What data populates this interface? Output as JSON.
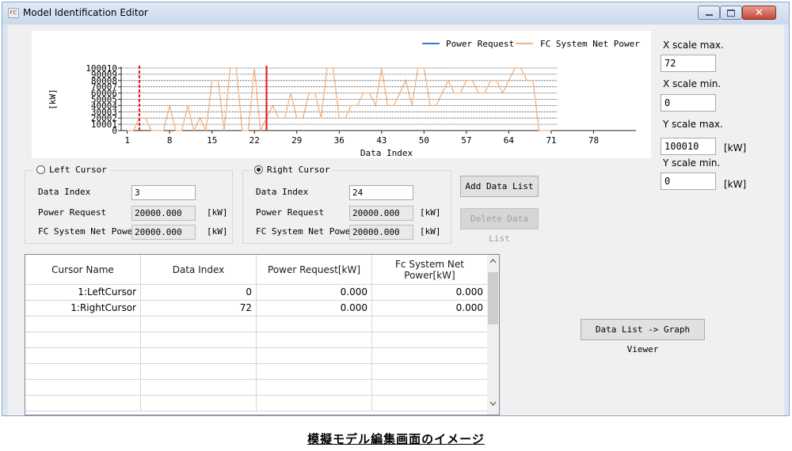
{
  "window": {
    "title": "Model Identification Editor",
    "app_icon": "model-app-icon"
  },
  "chart_data": {
    "type": "line",
    "xlabel": "Data Index",
    "ylabel": "[kW]",
    "xlim": [
      0,
      85
    ],
    "ylim": [
      0,
      100010
    ],
    "x_ticks": [
      1,
      8,
      15,
      22,
      29,
      36,
      43,
      50,
      57,
      64,
      71,
      78
    ],
    "y_ticks": [
      0,
      10001,
      20002,
      30003,
      40004,
      50005,
      60006,
      70007,
      80008,
      90009,
      100010
    ],
    "legend_position": "top-right",
    "grid": true,
    "series": [
      {
        "name": "Power Request",
        "color": "#3a78d6",
        "values": []
      },
      {
        "name": "FC System Net Power",
        "color": "#f0b383",
        "x": [
          1,
          2,
          3,
          4,
          5,
          6,
          7,
          8,
          9,
          10,
          11,
          12,
          13,
          14,
          15,
          16,
          17,
          18,
          19,
          20,
          21,
          22,
          23,
          24,
          25,
          26,
          27,
          28,
          29,
          30,
          31,
          32,
          33,
          34,
          35,
          36,
          37,
          38,
          39,
          40,
          41,
          42,
          43,
          44,
          45,
          46,
          47,
          48,
          49,
          50,
          51,
          52,
          53,
          54,
          55,
          56,
          57,
          58,
          59,
          60,
          61,
          62,
          63,
          64,
          65,
          66,
          67,
          68,
          69,
          70,
          71
        ],
        "values": [
          0,
          0,
          20000,
          20000,
          0,
          0,
          0,
          40000,
          0,
          0,
          40000,
          0,
          20000,
          0,
          80000,
          80000,
          0,
          100000,
          100000,
          0,
          0,
          100000,
          0,
          20000,
          40000,
          20000,
          20000,
          60000,
          20000,
          20000,
          60000,
          60000,
          20000,
          100000,
          100000,
          20000,
          20000,
          40000,
          40000,
          60000,
          60000,
          40000,
          100000,
          40000,
          40000,
          60000,
          80000,
          40000,
          100000,
          100000,
          40000,
          40000,
          60000,
          80000,
          60000,
          60000,
          80000,
          80000,
          60000,
          60000,
          80000,
          80000,
          60000,
          80000,
          100000,
          100000,
          80000,
          80000,
          0,
          0,
          0
        ]
      }
    ],
    "cursors": [
      {
        "name": "Left Cursor",
        "index": 3,
        "color": "#e8222a",
        "dashed": true
      },
      {
        "name": "Right Cursor",
        "index": 24,
        "color": "#e8222a",
        "dashed": false
      }
    ]
  },
  "scale": {
    "x_max_label": "X scale max.",
    "x_max": "72",
    "x_min_label": "X scale min.",
    "x_min": "0",
    "y_max_label": "Y scale max.",
    "y_max": "100010",
    "y_max_unit": "[kW]",
    "y_min_label": "Y scale min.",
    "y_min": "0",
    "y_min_unit": "[kW]"
  },
  "left_cursor": {
    "title": "Left Cursor",
    "selected": false,
    "index_label": "Data Index",
    "index": "3",
    "power_label": "Power Request",
    "power": "20000.000",
    "power_unit": "[kW]",
    "fc_label": "FC System Net Power",
    "fc": "20000.000",
    "fc_unit": "[kW]"
  },
  "right_cursor": {
    "title": "Right Cursor",
    "selected": true,
    "index_label": "Data Index",
    "index": "24",
    "power_label": "Power Request",
    "power": "20000.000",
    "power_unit": "[kW]",
    "fc_label": "FC System Net Power",
    "fc": "20000.000",
    "fc_unit": "[kW]"
  },
  "buttons": {
    "add": "Add Data List",
    "delete": "Delete Data List",
    "graph_viewer": "Data List -> Graph Viewer"
  },
  "table": {
    "headers": [
      "Cursor Name",
      "Data Index",
      "Power Request[kW]",
      "Fc System Net Power[kW]"
    ],
    "rows": [
      [
        "1:LeftCursor",
        "0",
        "0.000",
        "0.000"
      ],
      [
        "1:RightCursor",
        "72",
        "0.000",
        "0.000"
      ],
      [
        "",
        "",
        "",
        ""
      ],
      [
        "",
        "",
        "",
        ""
      ],
      [
        "",
        "",
        "",
        ""
      ],
      [
        "",
        "",
        "",
        ""
      ],
      [
        "",
        "",
        "",
        ""
      ],
      [
        "",
        "",
        "",
        ""
      ]
    ]
  },
  "caption": "模擬モデル編集画面のイメージ"
}
